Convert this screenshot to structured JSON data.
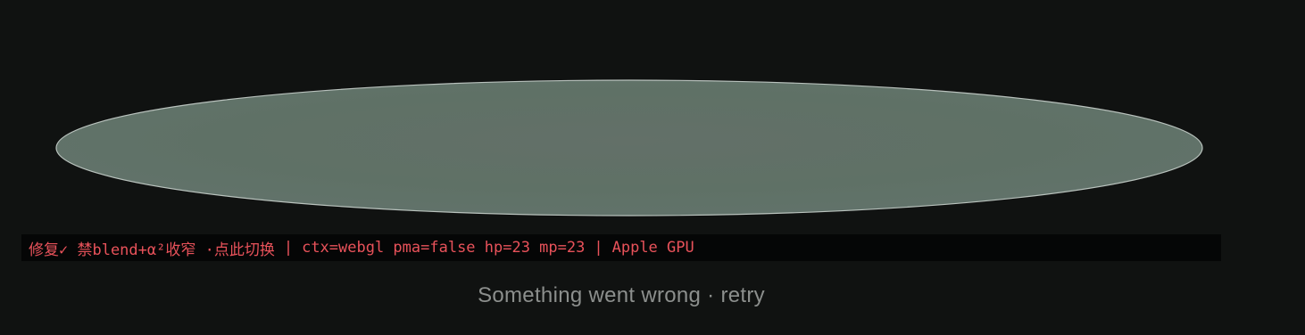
{
  "viewer": {
    "shape_fill": "#60716a",
    "shape_fill_center": "#637068",
    "shape_edge": "#b9c2bd",
    "background": "#101211"
  },
  "debug": {
    "toggle_label": "修复✓ 禁blend+α²收窄 ·点此切换",
    "divider": "|",
    "context_info": "ctx=webgl pma=false hp=23 mp=23",
    "gpu": "Apple GPU",
    "text_color": "#e8525a"
  },
  "status": {
    "message": "Something went wrong",
    "separator": "·",
    "retry_label": "retry"
  }
}
